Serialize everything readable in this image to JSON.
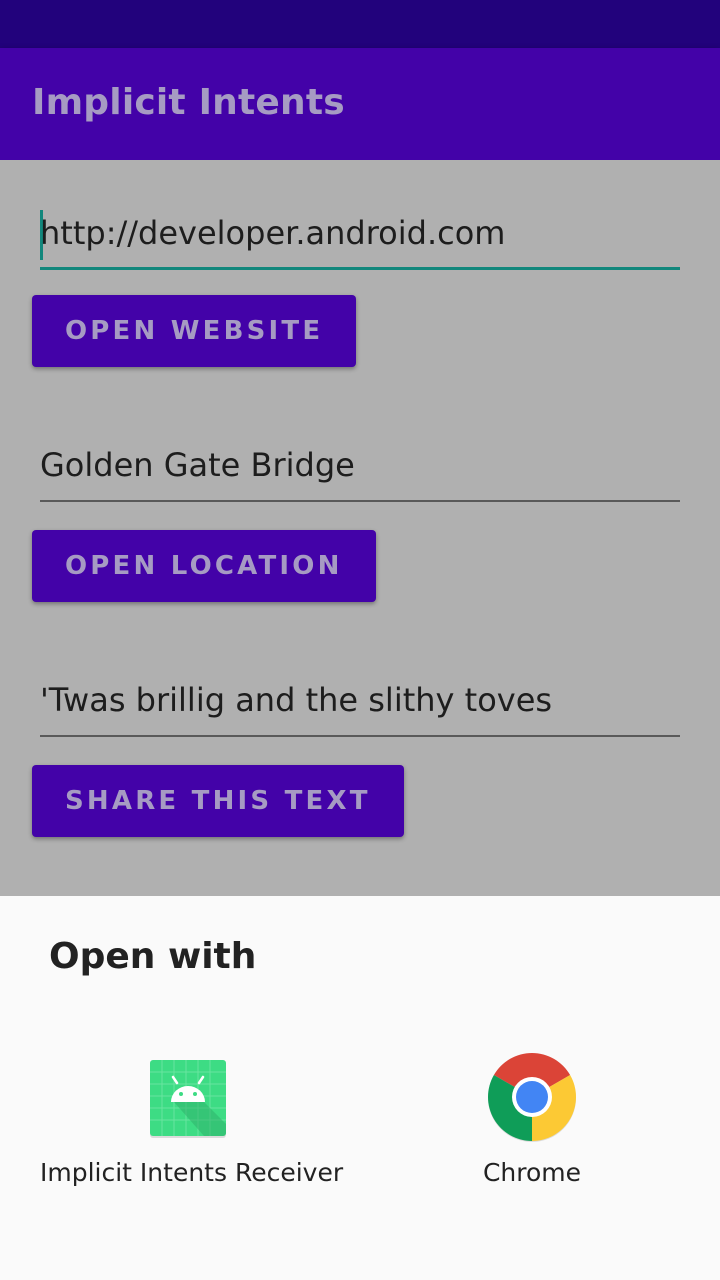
{
  "app_bar": {
    "title": "Implicit Intents"
  },
  "form": {
    "website": {
      "value": "http://developer.android.com",
      "button_label": "OPEN WEBSITE"
    },
    "location": {
      "value": "Golden Gate Bridge",
      "button_label": "OPEN LOCATION"
    },
    "share": {
      "value": "'Twas brillig and the slithy toves",
      "button_label": "SHARE THIS TEXT"
    }
  },
  "chooser": {
    "title": "Open with",
    "apps": [
      {
        "label": "Implicit Intents Receiver",
        "icon": "android-app-icon"
      },
      {
        "label": "Chrome",
        "icon": "chrome-icon"
      }
    ]
  },
  "colors": {
    "status_bar": "#22027c",
    "app_bar": "#4302a8",
    "button": "#4302a8",
    "accent": "#12877c",
    "scrim_background": "#b0b0b0",
    "sheet_background": "#fafafa"
  }
}
